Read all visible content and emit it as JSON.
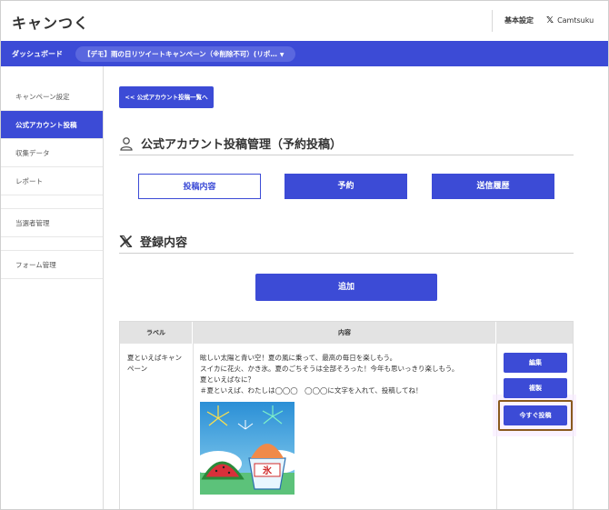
{
  "header": {
    "logo": "キャンつく",
    "settings_link": "基本設定",
    "account_link": "Camtsuku"
  },
  "bluebar": {
    "dashboard_label": "ダッシュボード",
    "campaign_select": "【デモ】雨の日リツイートキャンペーン（※削除不可）(リポ…"
  },
  "sidebar": {
    "items": [
      {
        "label": "キャンペーン設定"
      },
      {
        "label": "公式アカウント投稿"
      },
      {
        "label": "収集データ"
      },
      {
        "label": "レポート"
      },
      {
        "label": "当選者管理"
      },
      {
        "label": "フォーム管理"
      }
    ]
  },
  "main": {
    "back_button": "<< 公式アカウント投稿一覧へ",
    "section1_title": "公式アカウント投稿管理（予約投稿）",
    "tabs": [
      {
        "label": "投稿内容"
      },
      {
        "label": "予約"
      },
      {
        "label": "送信履歴"
      }
    ],
    "section2_title": "登録内容",
    "add_button": "追加"
  },
  "table": {
    "headers": [
      "ラベル",
      "内容",
      ""
    ],
    "rows": [
      {
        "label": "夏といえばキャンペーン",
        "content_lines": [
          "眩しい太陽と青い空！夏の風に乗って、最高の毎日を楽しもう。",
          "スイカに花火、かき氷。夏のごちそうは全部そろった！今年も思いっきり楽しもう。",
          "夏といえばなに？",
          "＃夏といえば、わたしは◯◯◯　◯◯◯に文字を入れて、投稿してね！"
        ],
        "image_text": "氷",
        "actions": {
          "edit": "編集",
          "copy": "複製",
          "post_now": "今すぐ投稿"
        }
      }
    ]
  },
  "colors": {
    "primary": "#3c4bd6",
    "highlight_border": "#8a5a1e"
  }
}
